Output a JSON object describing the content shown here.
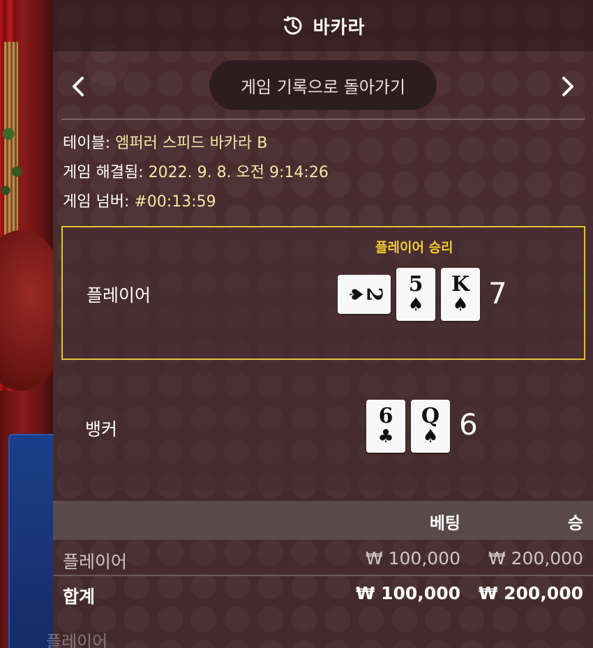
{
  "header": {
    "title": "바카라",
    "icon": "history-clock-icon"
  },
  "nav": {
    "back_label": "게임 기록으로 돌아가기",
    "prev_icon": "chevron-left-icon",
    "next_icon": "chevron-right-icon"
  },
  "info": {
    "table_label": "테이블:",
    "table_value": "엠퍼러 스피드 바카라 B",
    "resolved_label": "게임 해결됨:",
    "resolved_value": "2022. 9. 8. 오전 9:14:26",
    "number_label": "게임 넘버:",
    "number_value": "#00:13:59"
  },
  "player": {
    "label": "플레이어",
    "outcome": "플레이어 승리",
    "cards": [
      {
        "rank": "2",
        "suit": "♠",
        "rotated": true
      },
      {
        "rank": "5",
        "suit": "♠"
      },
      {
        "rank": "K",
        "suit": "♠"
      }
    ],
    "total": "7"
  },
  "banker": {
    "label": "뱅커",
    "cards": [
      {
        "rank": "6",
        "suit": "♣"
      },
      {
        "rank": "Q",
        "suit": "♠"
      }
    ],
    "total": "6"
  },
  "table": {
    "col_bet": "베팅",
    "col_win": "승",
    "rows": [
      {
        "name": "플레이어",
        "bet": "₩ 100,000",
        "win": "₩ 200,000"
      },
      {
        "name": "합계",
        "bet": "₩ 100,000",
        "win": "₩ 200,000"
      }
    ]
  },
  "background": {
    "faded_text": "플레이어"
  },
  "colors": {
    "accent_gold": "#e2c13a",
    "value_text": "#f6e6a8",
    "panel": "#4a2b2e"
  }
}
